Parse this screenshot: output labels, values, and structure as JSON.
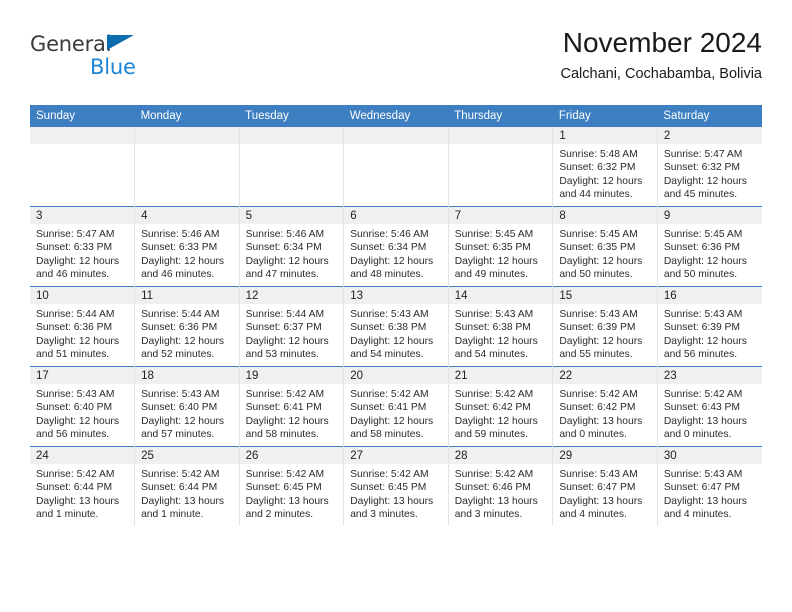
{
  "brand": {
    "name_part1": "General",
    "name_part2": "Blue",
    "triangle_color": "#0d6bb0",
    "blue_color": "#1d84d6"
  },
  "header": {
    "title": "November 2024",
    "subtitle": "Calchani, Cochabamba, Bolivia"
  },
  "theme": {
    "header_row_color": "#3d7fc1",
    "daynum_band_color": "#f0f0f0",
    "grid_line_color": "#e3e3e3"
  },
  "weekday_headers": [
    "Sunday",
    "Monday",
    "Tuesday",
    "Wednesday",
    "Thursday",
    "Friday",
    "Saturday"
  ],
  "weeks": [
    [
      {
        "day": "",
        "empty": true
      },
      {
        "day": "",
        "empty": true
      },
      {
        "day": "",
        "empty": true
      },
      {
        "day": "",
        "empty": true
      },
      {
        "day": "",
        "empty": true
      },
      {
        "day": "1",
        "sunrise": "Sunrise: 5:48 AM",
        "sunset": "Sunset: 6:32 PM",
        "daylight": "Daylight: 12 hours and 44 minutes."
      },
      {
        "day": "2",
        "sunrise": "Sunrise: 5:47 AM",
        "sunset": "Sunset: 6:32 PM",
        "daylight": "Daylight: 12 hours and 45 minutes."
      }
    ],
    [
      {
        "day": "3",
        "sunrise": "Sunrise: 5:47 AM",
        "sunset": "Sunset: 6:33 PM",
        "daylight": "Daylight: 12 hours and 46 minutes."
      },
      {
        "day": "4",
        "sunrise": "Sunrise: 5:46 AM",
        "sunset": "Sunset: 6:33 PM",
        "daylight": "Daylight: 12 hours and 46 minutes."
      },
      {
        "day": "5",
        "sunrise": "Sunrise: 5:46 AM",
        "sunset": "Sunset: 6:34 PM",
        "daylight": "Daylight: 12 hours and 47 minutes."
      },
      {
        "day": "6",
        "sunrise": "Sunrise: 5:46 AM",
        "sunset": "Sunset: 6:34 PM",
        "daylight": "Daylight: 12 hours and 48 minutes."
      },
      {
        "day": "7",
        "sunrise": "Sunrise: 5:45 AM",
        "sunset": "Sunset: 6:35 PM",
        "daylight": "Daylight: 12 hours and 49 minutes."
      },
      {
        "day": "8",
        "sunrise": "Sunrise: 5:45 AM",
        "sunset": "Sunset: 6:35 PM",
        "daylight": "Daylight: 12 hours and 50 minutes."
      },
      {
        "day": "9",
        "sunrise": "Sunrise: 5:45 AM",
        "sunset": "Sunset: 6:36 PM",
        "daylight": "Daylight: 12 hours and 50 minutes."
      }
    ],
    [
      {
        "day": "10",
        "sunrise": "Sunrise: 5:44 AM",
        "sunset": "Sunset: 6:36 PM",
        "daylight": "Daylight: 12 hours and 51 minutes."
      },
      {
        "day": "11",
        "sunrise": "Sunrise: 5:44 AM",
        "sunset": "Sunset: 6:36 PM",
        "daylight": "Daylight: 12 hours and 52 minutes."
      },
      {
        "day": "12",
        "sunrise": "Sunrise: 5:44 AM",
        "sunset": "Sunset: 6:37 PM",
        "daylight": "Daylight: 12 hours and 53 minutes."
      },
      {
        "day": "13",
        "sunrise": "Sunrise: 5:43 AM",
        "sunset": "Sunset: 6:38 PM",
        "daylight": "Daylight: 12 hours and 54 minutes."
      },
      {
        "day": "14",
        "sunrise": "Sunrise: 5:43 AM",
        "sunset": "Sunset: 6:38 PM",
        "daylight": "Daylight: 12 hours and 54 minutes."
      },
      {
        "day": "15",
        "sunrise": "Sunrise: 5:43 AM",
        "sunset": "Sunset: 6:39 PM",
        "daylight": "Daylight: 12 hours and 55 minutes."
      },
      {
        "day": "16",
        "sunrise": "Sunrise: 5:43 AM",
        "sunset": "Sunset: 6:39 PM",
        "daylight": "Daylight: 12 hours and 56 minutes."
      }
    ],
    [
      {
        "day": "17",
        "sunrise": "Sunrise: 5:43 AM",
        "sunset": "Sunset: 6:40 PM",
        "daylight": "Daylight: 12 hours and 56 minutes."
      },
      {
        "day": "18",
        "sunrise": "Sunrise: 5:43 AM",
        "sunset": "Sunset: 6:40 PM",
        "daylight": "Daylight: 12 hours and 57 minutes."
      },
      {
        "day": "19",
        "sunrise": "Sunrise: 5:42 AM",
        "sunset": "Sunset: 6:41 PM",
        "daylight": "Daylight: 12 hours and 58 minutes."
      },
      {
        "day": "20",
        "sunrise": "Sunrise: 5:42 AM",
        "sunset": "Sunset: 6:41 PM",
        "daylight": "Daylight: 12 hours and 58 minutes."
      },
      {
        "day": "21",
        "sunrise": "Sunrise: 5:42 AM",
        "sunset": "Sunset: 6:42 PM",
        "daylight": "Daylight: 12 hours and 59 minutes."
      },
      {
        "day": "22",
        "sunrise": "Sunrise: 5:42 AM",
        "sunset": "Sunset: 6:42 PM",
        "daylight": "Daylight: 13 hours and 0 minutes."
      },
      {
        "day": "23",
        "sunrise": "Sunrise: 5:42 AM",
        "sunset": "Sunset: 6:43 PM",
        "daylight": "Daylight: 13 hours and 0 minutes."
      }
    ],
    [
      {
        "day": "24",
        "sunrise": "Sunrise: 5:42 AM",
        "sunset": "Sunset: 6:44 PM",
        "daylight": "Daylight: 13 hours and 1 minute."
      },
      {
        "day": "25",
        "sunrise": "Sunrise: 5:42 AM",
        "sunset": "Sunset: 6:44 PM",
        "daylight": "Daylight: 13 hours and 1 minute."
      },
      {
        "day": "26",
        "sunrise": "Sunrise: 5:42 AM",
        "sunset": "Sunset: 6:45 PM",
        "daylight": "Daylight: 13 hours and 2 minutes."
      },
      {
        "day": "27",
        "sunrise": "Sunrise: 5:42 AM",
        "sunset": "Sunset: 6:45 PM",
        "daylight": "Daylight: 13 hours and 3 minutes."
      },
      {
        "day": "28",
        "sunrise": "Sunrise: 5:42 AM",
        "sunset": "Sunset: 6:46 PM",
        "daylight": "Daylight: 13 hours and 3 minutes."
      },
      {
        "day": "29",
        "sunrise": "Sunrise: 5:43 AM",
        "sunset": "Sunset: 6:47 PM",
        "daylight": "Daylight: 13 hours and 4 minutes."
      },
      {
        "day": "30",
        "sunrise": "Sunrise: 5:43 AM",
        "sunset": "Sunset: 6:47 PM",
        "daylight": "Daylight: 13 hours and 4 minutes."
      }
    ]
  ]
}
